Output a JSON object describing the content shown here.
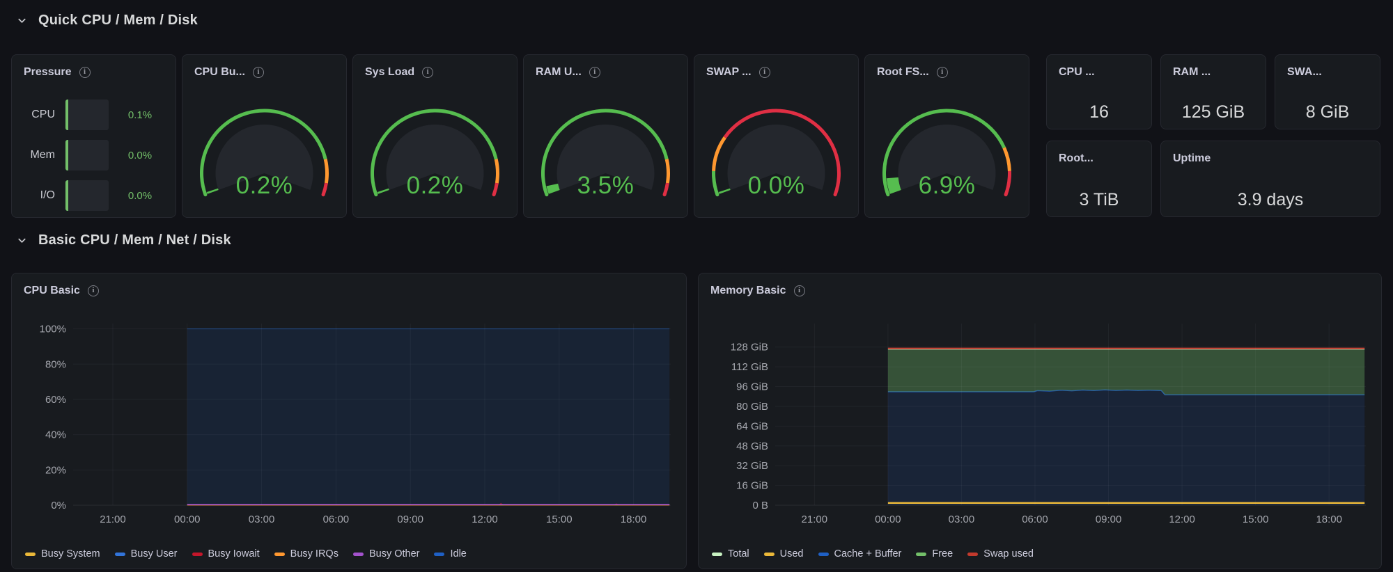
{
  "theme": {
    "background": "#111217",
    "panel": "#181B1F",
    "border": "#26282F",
    "text": "#CCCCDC",
    "green": "#73BF69",
    "orange": "#FF9830",
    "red": "#E02F44"
  },
  "rows": [
    {
      "title": "Quick CPU / Mem / Disk"
    },
    {
      "title": "Basic CPU / Mem / Net / Disk"
    }
  ],
  "pressure": {
    "title": "Pressure",
    "rows": [
      {
        "label": "CPU",
        "value": "0.1%",
        "percent": 0.1
      },
      {
        "label": "Mem",
        "value": "0.0%",
        "percent": 0.0
      },
      {
        "label": "I/O",
        "value": "0.0%",
        "percent": 0.0
      }
    ]
  },
  "gauges": [
    {
      "title": "CPU Bu...",
      "value": "0.2%",
      "percent": 0.2,
      "value_color": "#56BD4F",
      "thresholds": [
        {
          "to": 85,
          "color": "#56BD4F"
        },
        {
          "to": 95,
          "color": "#FF9830"
        },
        {
          "to": 100,
          "color": "#E02F44"
        }
      ]
    },
    {
      "title": "Sys Load",
      "value": "0.2%",
      "percent": 0.2,
      "value_color": "#56BD4F",
      "thresholds": [
        {
          "to": 85,
          "color": "#56BD4F"
        },
        {
          "to": 95,
          "color": "#FF9830"
        },
        {
          "to": 100,
          "color": "#E02F44"
        }
      ]
    },
    {
      "title": "RAM U...",
      "value": "3.5%",
      "percent": 3.5,
      "value_color": "#56BD4F",
      "thresholds": [
        {
          "to": 85,
          "color": "#56BD4F"
        },
        {
          "to": 95,
          "color": "#FF9830"
        },
        {
          "to": 100,
          "color": "#E02F44"
        }
      ]
    },
    {
      "title": "SWAP ...",
      "value": "0.0%",
      "percent": 0.0,
      "value_color": "#56BD4F",
      "thresholds": [
        {
          "to": 10,
          "color": "#56BD4F"
        },
        {
          "to": 25,
          "color": "#FF9830"
        },
        {
          "to": 100,
          "color": "#E02F44"
        }
      ]
    },
    {
      "title": "Root FS...",
      "value": "6.9%",
      "percent": 6.9,
      "value_color": "#56BD4F",
      "thresholds": [
        {
          "to": 80,
          "color": "#56BD4F"
        },
        {
          "to": 90,
          "color": "#FF9830"
        },
        {
          "to": 100,
          "color": "#E02F44"
        }
      ]
    }
  ],
  "stats": [
    {
      "title": "CPU ...",
      "value": "16"
    },
    {
      "title": "RAM ...",
      "value": "125 GiB"
    },
    {
      "title": "SWA...",
      "value": "8 GiB"
    },
    {
      "title": "Root...",
      "value": "3 TiB"
    },
    {
      "title": "Uptime",
      "value": "3.9 days"
    }
  ],
  "chart_data": [
    {
      "type": "area",
      "title": "CPU Basic",
      "xlabel": "",
      "ylabel": "",
      "xlim": [
        -4.6,
        19.5
      ],
      "ylim": [
        0,
        100
      ],
      "y_render_max": 103,
      "grid": true,
      "legend_position": "bottom",
      "x_ticks": [
        {
          "h": -3,
          "label": "21:00"
        },
        {
          "h": 0,
          "label": "00:00"
        },
        {
          "h": 3,
          "label": "03:00"
        },
        {
          "h": 6,
          "label": "06:00"
        },
        {
          "h": 9,
          "label": "09:00"
        },
        {
          "h": 12,
          "label": "12:00"
        },
        {
          "h": 15,
          "label": "15:00"
        },
        {
          "h": 18,
          "label": "18:00"
        }
      ],
      "y_ticks": [
        {
          "v": 0,
          "label": "0%"
        },
        {
          "v": 20,
          "label": "20%"
        },
        {
          "v": 40,
          "label": "40%"
        },
        {
          "v": 60,
          "label": "60%"
        },
        {
          "v": 80,
          "label": "80%"
        },
        {
          "v": 100,
          "label": "100%"
        }
      ],
      "series": [
        {
          "name": "Busy System",
          "color": "#EAB839",
          "width": 1,
          "points": [
            [
              0,
              0.12
            ],
            [
              19.45,
              0.12
            ]
          ]
        },
        {
          "name": "Busy User",
          "color": "#3274D9",
          "width": 1,
          "points": [
            [
              0,
              0.2
            ],
            [
              19.45,
              0.2
            ]
          ]
        },
        {
          "name": "Busy Iowait",
          "color": "#C4162A",
          "width": 1,
          "points": [
            [
              0,
              0.12
            ],
            [
              12.55,
              0.12
            ],
            [
              12.65,
              0.85
            ],
            [
              12.8,
              0.12
            ],
            [
              17.2,
              0.12
            ],
            [
              17.3,
              0.7
            ],
            [
              17.45,
              0.12
            ],
            [
              19.45,
              0.12
            ]
          ]
        },
        {
          "name": "Busy IRQs",
          "color": "#FF9830",
          "width": 1,
          "points": [
            [
              0,
              0.1
            ],
            [
              19.45,
              0.1
            ]
          ]
        },
        {
          "name": "Busy Other",
          "color": "#A352CC",
          "width": 1.6,
          "points": [
            [
              0,
              0.35
            ],
            [
              19.45,
              0.35
            ]
          ]
        },
        {
          "name": "Idle",
          "color": "#1F60C4",
          "width": 1,
          "fill": "rgba(31,96,196,0.13)",
          "stroke": "rgba(31,96,196,0.6)",
          "points": [
            [
              0,
              100
            ],
            [
              19.45,
              100
            ]
          ]
        }
      ]
    },
    {
      "type": "area",
      "title": "Memory Basic",
      "xlabel": "",
      "ylabel": "",
      "xlim": [
        -4.6,
        19.5
      ],
      "ylim": [
        0,
        128
      ],
      "y_render_max": 147,
      "grid": true,
      "legend_position": "bottom",
      "x_ticks": [
        {
          "h": -3,
          "label": "21:00"
        },
        {
          "h": 0,
          "label": "00:00"
        },
        {
          "h": 3,
          "label": "03:00"
        },
        {
          "h": 6,
          "label": "06:00"
        },
        {
          "h": 9,
          "label": "09:00"
        },
        {
          "h": 12,
          "label": "12:00"
        },
        {
          "h": 15,
          "label": "15:00"
        },
        {
          "h": 18,
          "label": "18:00"
        }
      ],
      "y_ticks": [
        {
          "v": 0,
          "label": "0 B"
        },
        {
          "v": 16,
          "label": "16 GiB"
        },
        {
          "v": 32,
          "label": "32 GiB"
        },
        {
          "v": 48,
          "label": "48 GiB"
        },
        {
          "v": 64,
          "label": "64 GiB"
        },
        {
          "v": 80,
          "label": "80 GiB"
        },
        {
          "v": 96,
          "label": "96 GiB"
        },
        {
          "v": 112,
          "label": "112 GiB"
        },
        {
          "v": 128,
          "label": "128 GiB"
        }
      ],
      "series": [
        {
          "name": "Total",
          "color": "#C8F2C2",
          "width": 1.5,
          "points": [
            [
              0,
              126.4
            ],
            [
              19.45,
              126.4
            ]
          ]
        },
        {
          "name": "Used",
          "color": "#EAB839",
          "width": 2.5,
          "points": [
            [
              0,
              1.8
            ],
            [
              19.45,
              1.8
            ]
          ]
        },
        {
          "name": "Cache + Buffer",
          "color": "#1F60C4",
          "width": 1.5,
          "fill": "rgba(31,96,196,0.15)",
          "stroke": "rgba(31,96,196,0.8)",
          "points": [
            [
              0,
              91.8
            ],
            [
              5.95,
              91.8
            ],
            [
              6.1,
              92.7
            ],
            [
              6.6,
              92.3
            ],
            [
              7.05,
              93.1
            ],
            [
              7.5,
              92.6
            ],
            [
              7.95,
              93.2
            ],
            [
              8.4,
              92.8
            ],
            [
              8.85,
              93.3
            ],
            [
              9.3,
              92.9
            ],
            [
              9.75,
              93.2
            ],
            [
              10.2,
              92.9
            ],
            [
              10.6,
              93.1
            ],
            [
              11.15,
              92.8
            ],
            [
              11.3,
              89.3
            ],
            [
              19.45,
              89.3
            ]
          ]
        },
        {
          "name": "Free",
          "color": "#73BF69",
          "width": 0,
          "fill": "rgba(115,191,105,0.34)",
          "points": [
            [
              0,
              126.2
            ],
            [
              19.45,
              126.2
            ]
          ],
          "lower": [
            [
              0,
              91.8
            ],
            [
              5.95,
              91.8
            ],
            [
              6.1,
              92.7
            ],
            [
              6.6,
              92.3
            ],
            [
              7.05,
              93.1
            ],
            [
              7.5,
              92.6
            ],
            [
              7.95,
              93.2
            ],
            [
              8.4,
              92.8
            ],
            [
              8.85,
              93.3
            ],
            [
              9.3,
              92.9
            ],
            [
              9.75,
              93.2
            ],
            [
              10.2,
              92.9
            ],
            [
              10.6,
              93.1
            ],
            [
              11.15,
              92.8
            ],
            [
              11.3,
              89.3
            ],
            [
              19.45,
              89.3
            ]
          ]
        },
        {
          "name": "Swap used",
          "color": "#C23A2D",
          "width": 2.2,
          "points": [
            [
              0,
              126.9
            ],
            [
              19.45,
              126.9
            ]
          ]
        }
      ]
    }
  ]
}
